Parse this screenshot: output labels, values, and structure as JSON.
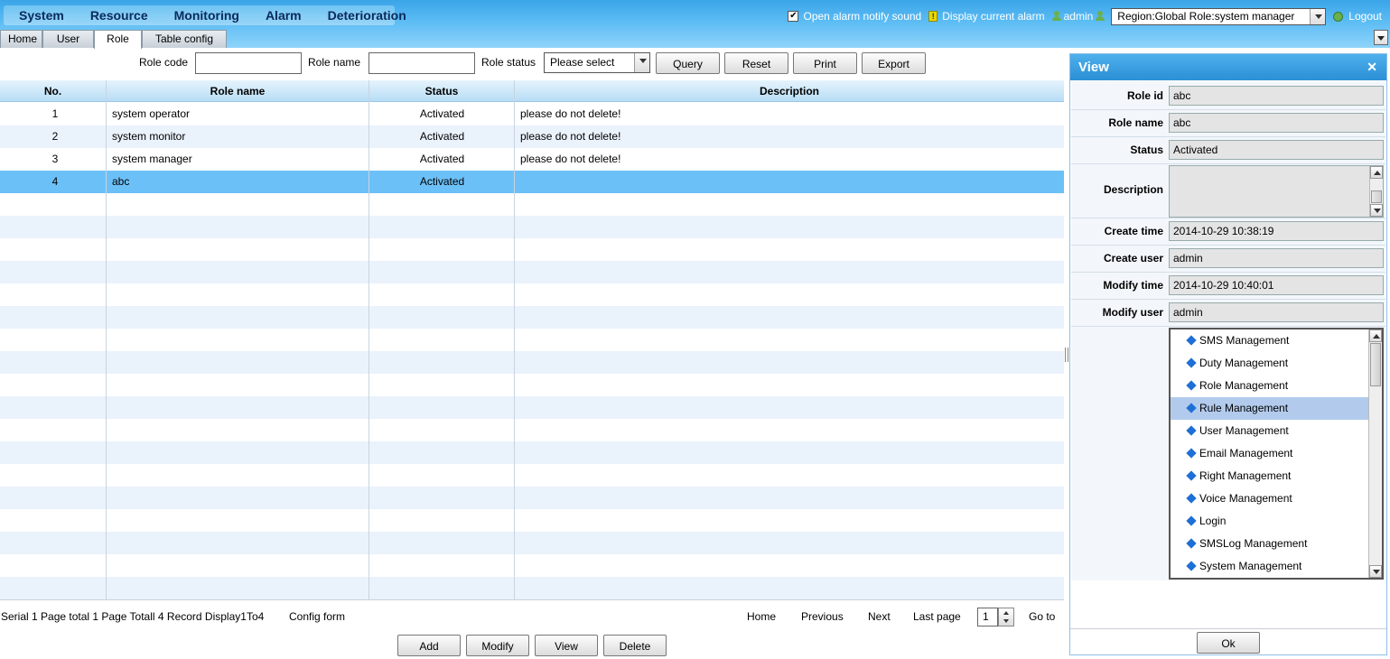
{
  "menu": [
    "System",
    "Resource",
    "Monitoring",
    "Alarm",
    "Deterioration"
  ],
  "tabs": [
    "Home",
    "User",
    "Role",
    "Table config"
  ],
  "top_right": {
    "alarm_sound_label": "Open alarm notify sound",
    "alarm_sound_checked": "✔",
    "display_alarm_label": "Display current alarm",
    "user": "admin",
    "region_role": "Region:Global Role:system manager",
    "logout": "Logout"
  },
  "filter": {
    "role_code_label": "Role code",
    "role_name_label": "Role name",
    "role_status_label": "Role status",
    "role_status_value": "Please select",
    "query": "Query",
    "reset": "Reset",
    "print": "Print",
    "export": "Export"
  },
  "table": {
    "headers": [
      "No.",
      "Role name",
      "Status",
      "Description"
    ],
    "rows": [
      [
        "1",
        "system operator",
        "Activated",
        "please do not delete!"
      ],
      [
        "2",
        "system monitor",
        "Activated",
        "please do not delete!"
      ],
      [
        "3",
        "system manager",
        "Activated",
        "please do not delete!"
      ],
      [
        "4",
        "abc",
        "Activated",
        ""
      ]
    ]
  },
  "pager": {
    "summary": "Serial 1 Page total 1 Page Totall 4 Record Display1To4",
    "config_form": "Config form",
    "home": "Home",
    "previous": "Previous",
    "next": "Next",
    "last_page": "Last page",
    "page": "1",
    "go_to": "Go to"
  },
  "actions": [
    "Add",
    "Modify",
    "View",
    "Delete"
  ],
  "view": {
    "title": "View",
    "close": "✕",
    "fields": [
      {
        "label": "Role id",
        "value": "abc"
      },
      {
        "label": "Role name",
        "value": "abc"
      },
      {
        "label": "Status",
        "value": "Activated"
      },
      {
        "label": "Description",
        "value": ""
      },
      {
        "label": "Create time",
        "value": "2014-10-29 10:38:19"
      },
      {
        "label": "Create user",
        "value": "admin"
      },
      {
        "label": "Modify time",
        "value": "2014-10-29 10:40:01"
      },
      {
        "label": "Modify user",
        "value": "admin"
      }
    ],
    "permissions": [
      "SMS Management",
      "Duty Management",
      "Role Management",
      "Rule Management",
      "User Management",
      "Email Management",
      "Right Management",
      "Voice Management",
      "Login",
      "SMSLog Management",
      "System Management"
    ],
    "selected_permission": "Rule Management",
    "ok": "Ok"
  },
  "colors": {
    "accent": "#2b8fd6",
    "selected_row": "#6cc0f8",
    "alt_row": "#eaf2fc"
  }
}
